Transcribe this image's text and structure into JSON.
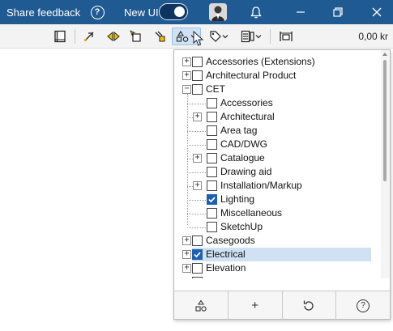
{
  "titlebar": {
    "feedback": "Share feedback",
    "help_icon": "?",
    "new_ui_label": "New UI",
    "toggle_on": true,
    "background": "#1f5a93"
  },
  "toolbar": {
    "distance": "0,00 kr",
    "buttons": [
      "catalog-book-icon",
      "measure-icon",
      "flip-icon",
      "select-box-icon",
      "paint-icon",
      "symbol-filter-icon",
      "tag-icon",
      "layers-icon",
      "ruler-icon"
    ]
  },
  "panel": {
    "tree": [
      {
        "label": "Accessories (Extensions)",
        "expander": "+",
        "checked": false
      },
      {
        "label": "Architectural Product",
        "expander": "+",
        "checked": false
      },
      {
        "label": "CET",
        "expander": "−",
        "checked": false
      },
      {
        "label": "Accessories",
        "expander": "",
        "checked": false
      },
      {
        "label": "Architectural",
        "expander": "+",
        "checked": false
      },
      {
        "label": "Area tag",
        "expander": "",
        "checked": false
      },
      {
        "label": "CAD/DWG",
        "expander": "",
        "checked": false
      },
      {
        "label": "Catalogue",
        "expander": "+",
        "checked": false
      },
      {
        "label": "Drawing aid",
        "expander": "",
        "checked": false
      },
      {
        "label": "Installation/Markup",
        "expander": "+",
        "checked": false
      },
      {
        "label": "Lighting",
        "expander": "",
        "checked": true
      },
      {
        "label": "Miscellaneous",
        "expander": "",
        "checked": false
      },
      {
        "label": "SketchUp",
        "expander": "",
        "checked": false
      },
      {
        "label": "Casegoods",
        "expander": "+",
        "checked": false
      },
      {
        "label": "Electrical",
        "expander": "+",
        "checked": true
      },
      {
        "label": "Elevation",
        "expander": "+",
        "checked": false
      }
    ],
    "footer": {
      "plus_label": "+",
      "help_label": "?"
    },
    "selection_color": "#cfe1f3"
  }
}
